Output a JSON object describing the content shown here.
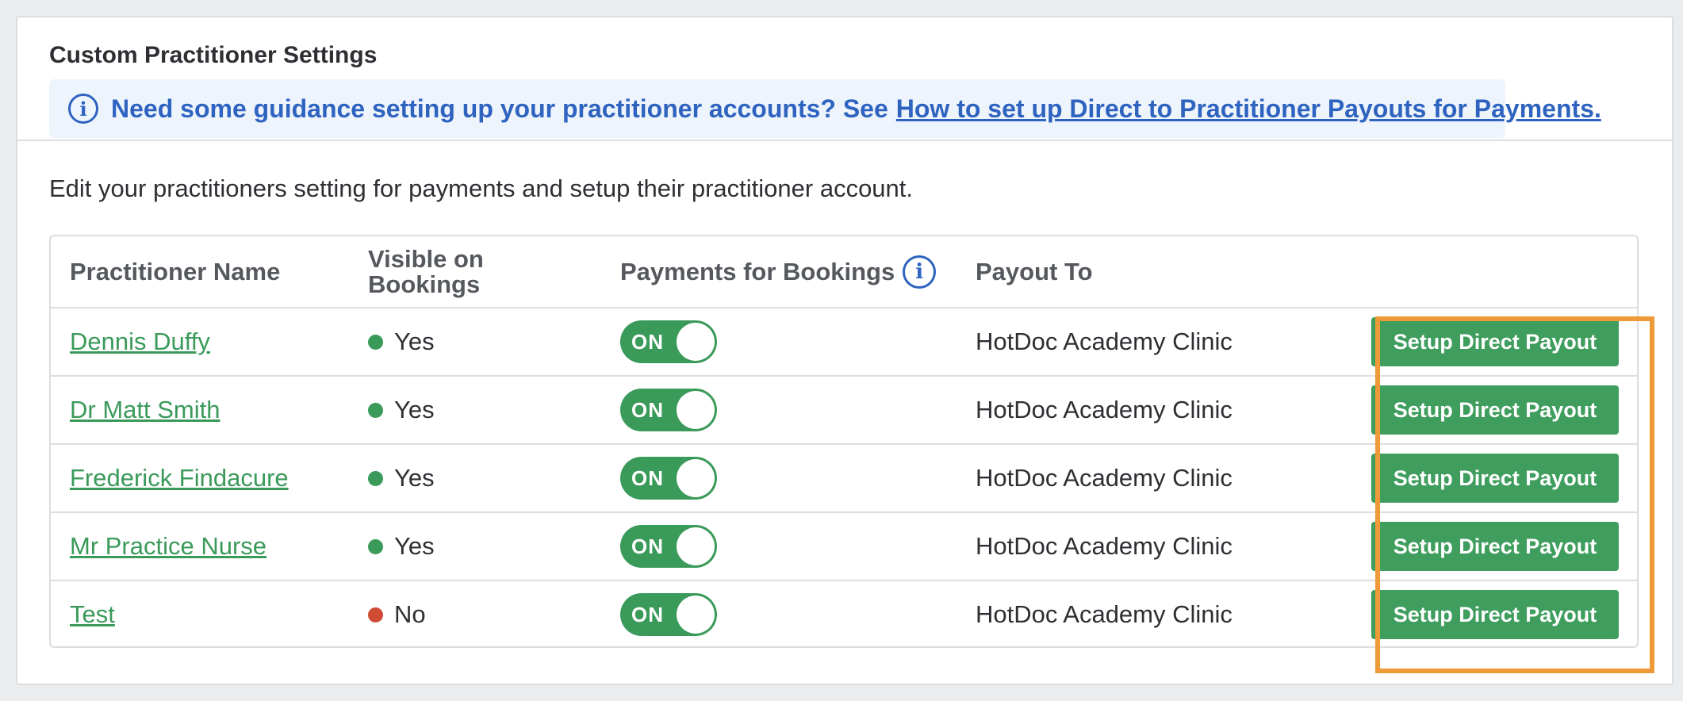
{
  "card": {
    "title": "Custom Practitioner Settings",
    "banner": {
      "text": "Need some guidance setting up your practitioner accounts? See",
      "link": "How to set up Direct to Practitioner Payouts for Payments."
    },
    "description": "Edit your practitioners setting for payments and setup their practitioner account."
  },
  "table": {
    "headers": {
      "name": "Practitioner Name",
      "visible_line1": "Visible on",
      "visible_line2": "Bookings",
      "payments": "Payments for Bookings",
      "payout_to": "Payout To"
    },
    "rows": [
      {
        "name": "Dennis Duffy",
        "visible": "Yes",
        "toggle": "ON",
        "payout_to": "HotDoc Academy Clinic",
        "action": "Setup Direct Payout"
      },
      {
        "name": "Dr Matt Smith",
        "visible": "Yes",
        "toggle": "ON",
        "payout_to": "HotDoc Academy Clinic",
        "action": "Setup Direct Payout"
      },
      {
        "name": "Frederick Findacure",
        "visible": "Yes",
        "toggle": "ON",
        "payout_to": "HotDoc Academy Clinic",
        "action": "Setup Direct Payout"
      },
      {
        "name": "Mr Practice Nurse",
        "visible": "Yes",
        "toggle": "ON",
        "payout_to": "HotDoc Academy Clinic",
        "action": "Setup Direct Payout"
      },
      {
        "name": "Test",
        "visible": "No",
        "toggle": "ON",
        "payout_to": "HotDoc Academy Clinic",
        "action": "Setup Direct Payout"
      }
    ]
  },
  "colors": {
    "accent_green": "#3a9a5a",
    "info_blue": "#2e63c0",
    "status_no": "#d04b33",
    "highlight_orange": "#ef9a38"
  },
  "icons": {
    "banner": "info-icon",
    "payments_header": "info-icon"
  }
}
